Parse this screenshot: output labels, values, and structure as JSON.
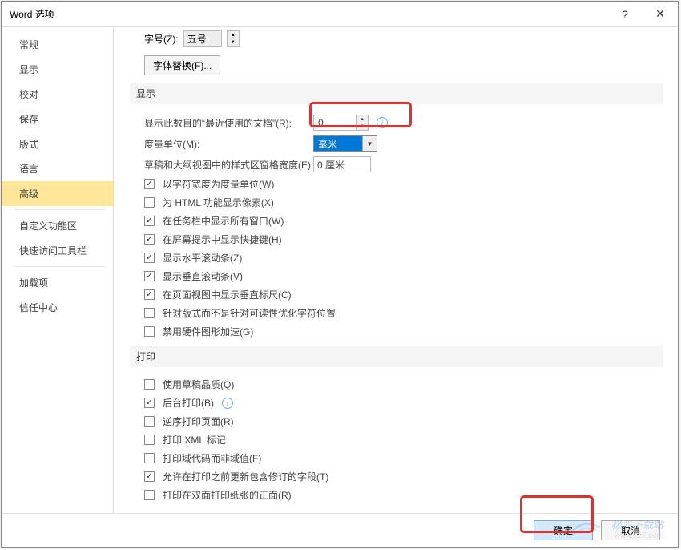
{
  "window": {
    "title": "Word 选项",
    "help": "?",
    "close": "✕"
  },
  "sidebar": {
    "items": [
      {
        "label": "常规"
      },
      {
        "label": "显示"
      },
      {
        "label": "校对"
      },
      {
        "label": "保存"
      },
      {
        "label": "版式"
      },
      {
        "label": "语言"
      },
      {
        "label": "高级",
        "active": true
      },
      {
        "label": "自定义功能区"
      },
      {
        "label": "快速访问工具栏"
      },
      {
        "label": "加载项"
      },
      {
        "label": "信任中心"
      }
    ]
  },
  "content": {
    "top": {
      "label": "字号(Z):",
      "value": "五号",
      "font_sub_btn": "字体替换(F)..."
    },
    "section_display": {
      "title": "显示",
      "recent_docs_label": "显示此数目的“最近使用的文档”(R):",
      "recent_docs_value": "0",
      "unit_label": "度量单位(M):",
      "unit_value": "毫米",
      "draft_width_label": "草稿和大纲视图中的样式区窗格宽度(E):",
      "draft_width_value": "0 厘米",
      "checks": [
        {
          "label": "以字符宽度为度量单位(W)",
          "checked": true
        },
        {
          "label": "为 HTML 功能显示像素(X)",
          "checked": false
        },
        {
          "label": "在任务栏中显示所有窗口(W)",
          "checked": true
        },
        {
          "label": "在屏幕提示中显示快捷键(H)",
          "checked": true
        },
        {
          "label": "显示水平滚动条(Z)",
          "checked": true
        },
        {
          "label": "显示垂直滚动条(V)",
          "checked": true
        },
        {
          "label": "在页面视图中显示垂直标尺(C)",
          "checked": true
        },
        {
          "label": "针对版式而不是针对可读性优化字符位置",
          "checked": false
        },
        {
          "label": "禁用硬件图形加速(G)",
          "checked": false
        }
      ]
    },
    "section_print": {
      "title": "打印",
      "checks": [
        {
          "label": "使用草稿品质(Q)",
          "checked": false
        },
        {
          "label": "后台打印(B)",
          "checked": true,
          "info": true
        },
        {
          "label": "逆序打印页面(R)",
          "checked": false
        },
        {
          "label": "打印 XML 标记",
          "checked": false
        },
        {
          "label": "打印域代码而非域值(F)",
          "checked": false
        },
        {
          "label": "允许在打印之前更新包含修订的字段(T)",
          "checked": true
        },
        {
          "label": "打印在双面打印纸张的正面(R)",
          "checked": false
        }
      ]
    }
  },
  "footer": {
    "ok": "确定",
    "cancel": "取消"
  },
  "watermark": {
    "main": "极光下载站",
    "sub": "www.xz7.com"
  }
}
